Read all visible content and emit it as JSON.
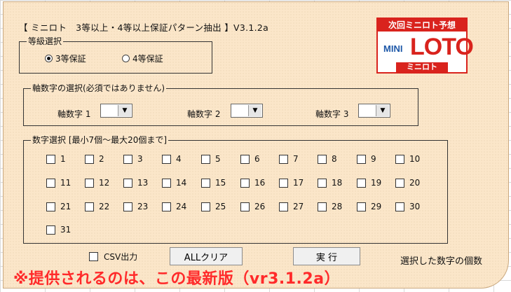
{
  "title": "【 ミニロト　3等以上・4等以上保証パターン抽出 】V3.1.2a",
  "logo": {
    "top_text": "次回ミニロト予想",
    "mini_text": "MINI",
    "loto_text": "LOTO",
    "bottom_text": "ミニロト"
  },
  "grade_selection": {
    "legend": "等級選択",
    "options": [
      {
        "label": "3等保証",
        "selected": true
      },
      {
        "label": "4等保証",
        "selected": false
      }
    ]
  },
  "axis_selection": {
    "legend": "軸数字の選択(必須ではありません)",
    "fields": [
      {
        "label": "軸数字 1",
        "value": ""
      },
      {
        "label": "軸数字 2",
        "value": ""
      },
      {
        "label": "軸数字 3",
        "value": ""
      }
    ],
    "dropdown_icon": "triangle-down-icon"
  },
  "number_selection": {
    "legend": "数字選択 [最小7個～最大20個まで]",
    "numbers": [
      "1",
      "2",
      "3",
      "4",
      "5",
      "6",
      "7",
      "8",
      "9",
      "10",
      "11",
      "12",
      "13",
      "14",
      "15",
      "16",
      "17",
      "18",
      "19",
      "20",
      "21",
      "22",
      "23",
      "24",
      "25",
      "26",
      "27",
      "28",
      "29",
      "30",
      "31"
    ]
  },
  "csv_label": "CSV出力",
  "clear_button": "ALLクリア",
  "run_button": "実 行",
  "count_label": "選択した数字の個数",
  "notice": "※提供されるのは、この最新版（vr3.1.2a）",
  "colors": {
    "panel_bg": "#fbe6c9",
    "notice": "#ff2a2a",
    "logo_red": "#d9231d",
    "logo_blue": "#1d58a8"
  }
}
